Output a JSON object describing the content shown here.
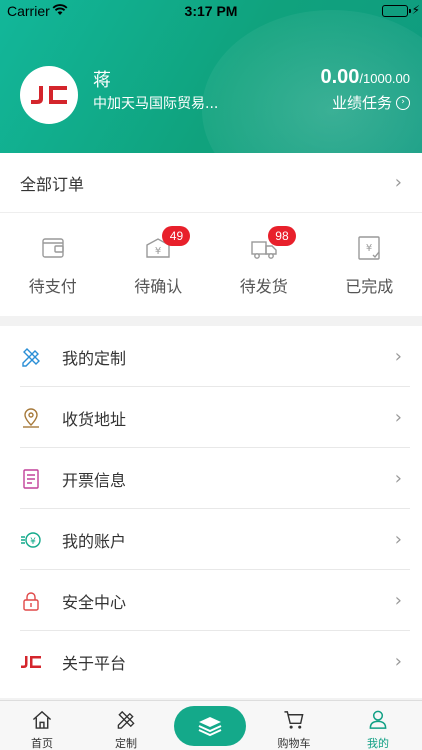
{
  "status_bar": {
    "carrier": "Carrier",
    "time": "3:17 PM"
  },
  "profile": {
    "name": "蒋",
    "company": "中加天马国际贸易...",
    "logo_text": "JC",
    "performance_current": "0.00",
    "performance_target": "/1000.00",
    "performance_task_label": "业绩任务"
  },
  "orders": {
    "title": "全部订单",
    "items": [
      {
        "label": "待支付",
        "icon": "wallet-icon"
      },
      {
        "label": "待确认",
        "icon": "yen-box-icon",
        "badge": "49"
      },
      {
        "label": "待发货",
        "icon": "truck-icon",
        "badge": "98"
      },
      {
        "label": "已完成",
        "icon": "yen-check-icon"
      }
    ]
  },
  "menu": {
    "items": [
      {
        "label": "我的定制",
        "icon": "pencil-ruler-icon"
      },
      {
        "label": "收货地址",
        "icon": "location-pin-icon"
      },
      {
        "label": "开票信息",
        "icon": "invoice-icon"
      },
      {
        "label": "我的账户",
        "icon": "yen-coin-icon"
      },
      {
        "label": "安全中心",
        "icon": "lock-icon"
      },
      {
        "label": "关于平台",
        "icon": "jc-logo-icon"
      }
    ]
  },
  "tabbar": {
    "items": [
      {
        "label": "首页",
        "icon": "home-icon"
      },
      {
        "label": "定制",
        "icon": "pencil-ruler-icon"
      },
      {
        "label": "",
        "icon": "layers-icon"
      },
      {
        "label": "购物车",
        "icon": "cart-icon"
      },
      {
        "label": "我的",
        "icon": "user-icon"
      }
    ],
    "active": "我的"
  },
  "colors": {
    "brand_green": "#12b79a",
    "badge_red": "#e8202b",
    "logo_red": "#d4252c",
    "active_tab": "#11a085"
  }
}
